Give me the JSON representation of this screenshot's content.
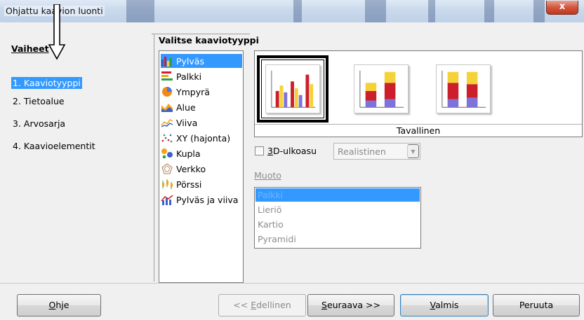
{
  "window": {
    "title": "Ohjattu kaavion luonti",
    "close_glyph": "x"
  },
  "steps": {
    "heading": "Vaiheet",
    "items": [
      {
        "label": "1. Kaaviotyyppi",
        "active": true
      },
      {
        "label": "2. Tietoalue"
      },
      {
        "label": "3. Arvosarja"
      },
      {
        "label": "4. Kaavioelementit"
      }
    ]
  },
  "section_title": "Valitse kaaviotyyppi",
  "chart_types": [
    {
      "label": "Pylväs",
      "icon": "column-chart-icon",
      "selected": true
    },
    {
      "label": "Palkki",
      "icon": "bar-chart-icon"
    },
    {
      "label": "Ympyrä",
      "icon": "pie-chart-icon"
    },
    {
      "label": "Alue",
      "icon": "area-chart-icon"
    },
    {
      "label": "Viiva",
      "icon": "line-chart-icon"
    },
    {
      "label": "XY (hajonta)",
      "icon": "scatter-chart-icon"
    },
    {
      "label": "Kupla",
      "icon": "bubble-chart-icon"
    },
    {
      "label": "Verkko",
      "icon": "net-chart-icon"
    },
    {
      "label": "Pörssi",
      "icon": "stock-chart-icon"
    },
    {
      "label": "Pylväs ja viiva",
      "icon": "column-line-chart-icon"
    }
  ],
  "variants": {
    "selected_name": "Tavallinen",
    "items": [
      {
        "icon": "normal-column-icon",
        "selected": true
      },
      {
        "icon": "stacked-column-icon"
      },
      {
        "icon": "percent-stacked-column-icon"
      }
    ]
  },
  "three_d": {
    "checkbox_prefix": "",
    "checkbox_accel": "3",
    "checkbox_rest": "D-ulkoasu",
    "checked": false,
    "combo_value": "Realistinen"
  },
  "shape": {
    "label": "Muoto",
    "options": [
      {
        "label": "Palkki",
        "selected": true
      },
      {
        "label": "Lieriö"
      },
      {
        "label": "Kartio"
      },
      {
        "label": "Pyramidi"
      }
    ]
  },
  "buttons": {
    "help_accel": "O",
    "help_rest": "hje",
    "back_prefix": "<< ",
    "back_accel": "E",
    "back_rest": "dellinen",
    "next_accel": "S",
    "next_rest": "euraava >>",
    "finish_accel": "V",
    "finish_rest": "almis",
    "cancel": "Peruuta"
  },
  "colors": {
    "selection": "#3399ff",
    "bar_red": "#cc1f2a",
    "bar_yellow": "#f6d23a",
    "bar_blue": "#7e73d8"
  }
}
